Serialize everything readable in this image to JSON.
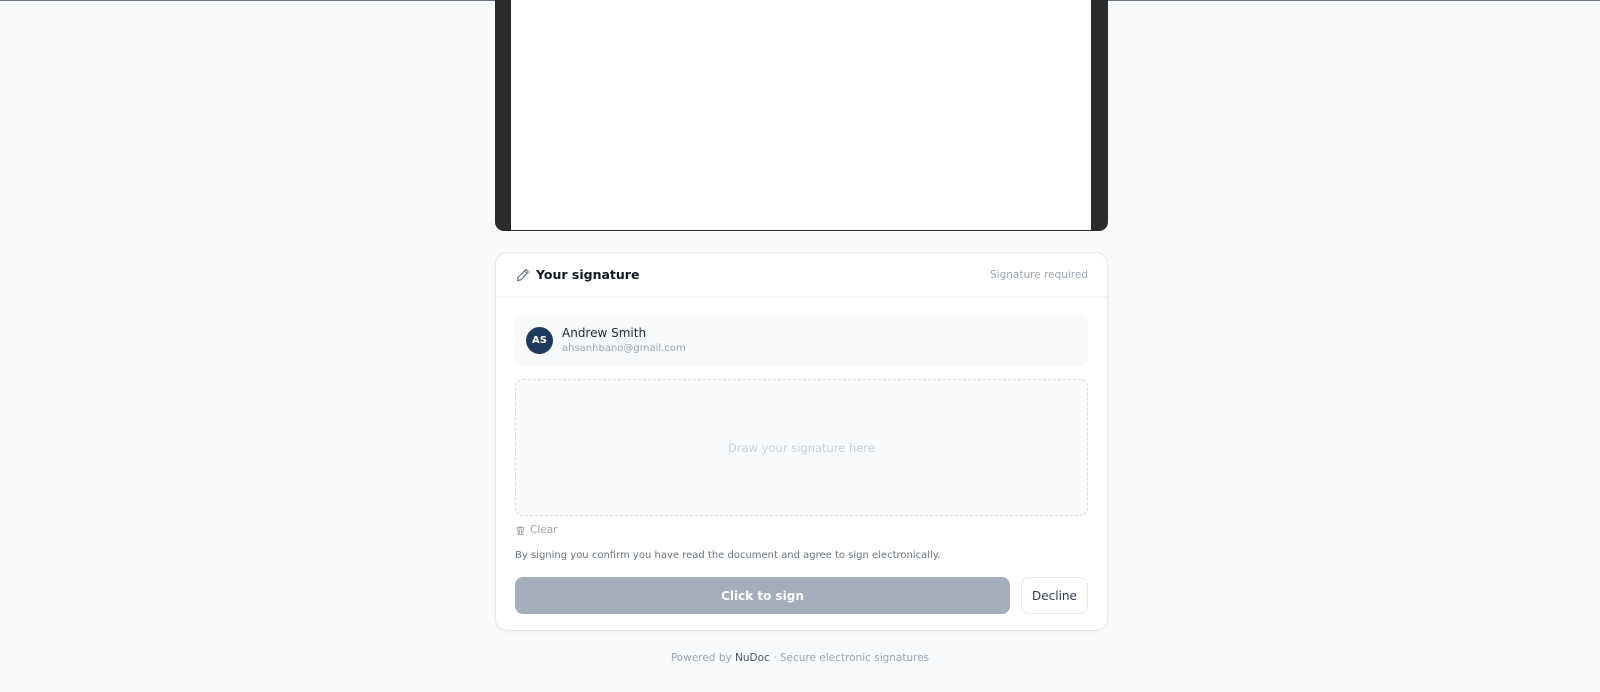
{
  "card": {
    "title": "Your signature",
    "status": "Signature required"
  },
  "signer": {
    "initials": "AS",
    "name": "Andrew Smith",
    "email": "ahsanhbano@gmail.com"
  },
  "pad": {
    "placeholder": "Draw your signature here",
    "clear_label": "Clear"
  },
  "consent_text": "By signing you confirm you have read the document and agree to sign electronically.",
  "actions": {
    "sign_label": "Click to sign",
    "decline_label": "Decline"
  },
  "footer": {
    "prefix": "Powered by",
    "brand": "NuDoc",
    "suffix": "· Secure electronic signatures"
  },
  "colors": {
    "avatar_bg": "#1e3a5f",
    "sign_button_disabled": "#a3adbb",
    "page_bg": "#f8fafc"
  }
}
